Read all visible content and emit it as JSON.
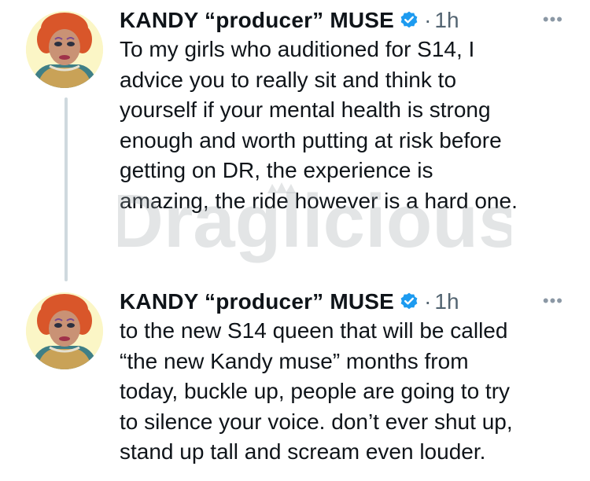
{
  "watermark_text": "Draglicious",
  "tweets": [
    {
      "display_name": "KANDY “producer” MUSE",
      "separator": "·",
      "time": "1h",
      "more_icon": "•••",
      "text": "To my girls who auditioned for S14, I\nadvice you to really sit and think to\nyourself if your mental health is strong\nenough and worth putting at risk before\ngetting on DR, the experience is\namazing, the ride however is a hard one."
    },
    {
      "display_name": "KANDY “producer” MUSE",
      "separator": "·",
      "time": "1h",
      "more_icon": "•••",
      "text": "to the new S14 queen that will be called\n“the new Kandy muse” months from\ntoday, buckle up, people are going to try\nto silence your voice. don’t ever shut up,\nstand up tall and scream even louder."
    }
  ],
  "colors": {
    "verified": "#1d9bf0",
    "muted": "#536471",
    "thread_line": "#cfd9de"
  }
}
